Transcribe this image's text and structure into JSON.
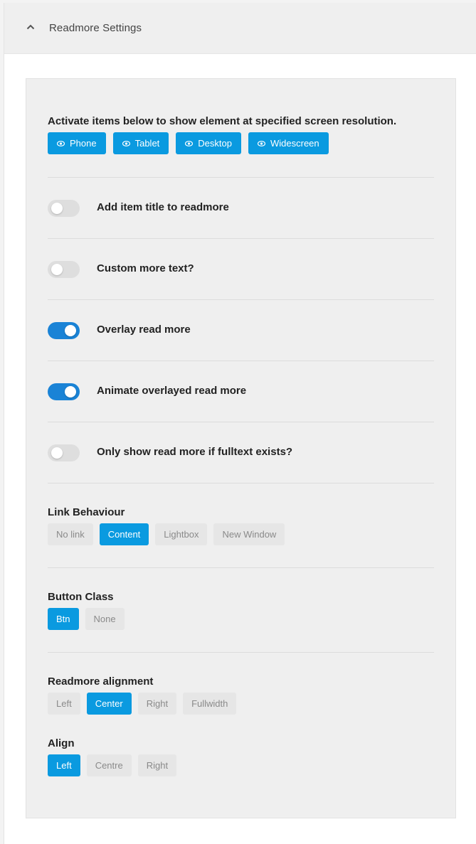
{
  "header": {
    "title": "Readmore Settings"
  },
  "visibility": {
    "label": "Activate items below to show element at specified screen resolution.",
    "buttons": [
      "Phone",
      "Tablet",
      "Desktop",
      "Widescreen"
    ]
  },
  "toggles": [
    {
      "label": "Add item title to readmore",
      "on": false
    },
    {
      "label": "Custom more text?",
      "on": false
    },
    {
      "label": "Overlay read more",
      "on": true
    },
    {
      "label": "Animate overlayed read more",
      "on": true
    },
    {
      "label": "Only show read more if fulltext exists?",
      "on": false
    }
  ],
  "link_behaviour": {
    "label": "Link Behaviour",
    "options": [
      "No link",
      "Content",
      "Lightbox",
      "New Window"
    ],
    "selected": "Content"
  },
  "button_class": {
    "label": "Button Class",
    "options": [
      "Btn",
      "None"
    ],
    "selected": "Btn"
  },
  "readmore_alignment": {
    "label": "Readmore alignment",
    "options": [
      "Left",
      "Center",
      "Right",
      "Fullwidth"
    ],
    "selected": "Center"
  },
  "align": {
    "label": "Align",
    "options": [
      "Left",
      "Centre",
      "Right"
    ],
    "selected": "Left"
  },
  "colors": {
    "accent": "#0a9ae0",
    "toggle_on": "#1a83d6",
    "toggle_off": "#dedede"
  }
}
